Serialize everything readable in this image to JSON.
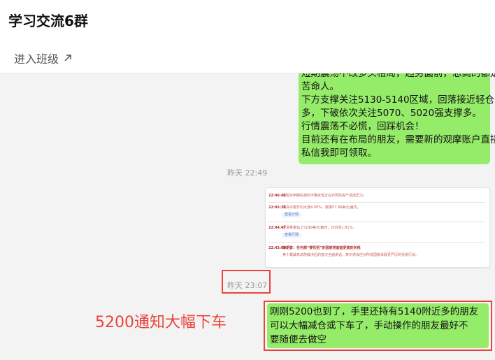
{
  "header": {
    "title": "学习交流6群",
    "enter_link": "进入班级"
  },
  "messages": {
    "first": {
      "lines": [
        "短期震荡不改多头格局，趋势面前，恐高的都是",
        "苦命人。",
        "下方支撑关注5130-5140区域，回落接近轻仓",
        "多，下破依次关注5070、5020强支撑多。",
        "行情震荡不必慌，回踩机会！",
        "目前还有在布局的朋友，需要新的观摩账户直接",
        "私信我即可领取。"
      ]
    },
    "timestamp1": "昨天 22:49",
    "image_news": [
      {
        "time": "22:46:46",
        "text": "欧盟对伊朗实施的不确定性正在对风险资产造成压力。"
      },
      {
        "time": "22:45:28",
        "text": "现货白银日内大涨4.00%，报报57.98美元/盎司。",
        "tag": "查看行情"
      },
      {
        "time": "22:44:47",
        "text": "现货黄金站上5190美元/盎司，日内涨1.81%。",
        "tag": "查看行情"
      },
      {
        "time": "22:43:03",
        "title": "特朗普：任何想“要花招”的国家将面临更高的关税",
        "text": "美十载最高法院裁决后的首次全面讲话，表示将会应对所有国家采取更严厉的贸易行动。"
      }
    ],
    "timestamp2": "昨天 23:07",
    "annotation": "5200通知大幅下车",
    "second": {
      "lines": [
        "刚刚5200也到了，手里还持有5140附近多的朋友",
        "可以大幅减仓或下车了，手动操作的朋友最好不",
        "要随便去做空"
      ]
    }
  }
}
